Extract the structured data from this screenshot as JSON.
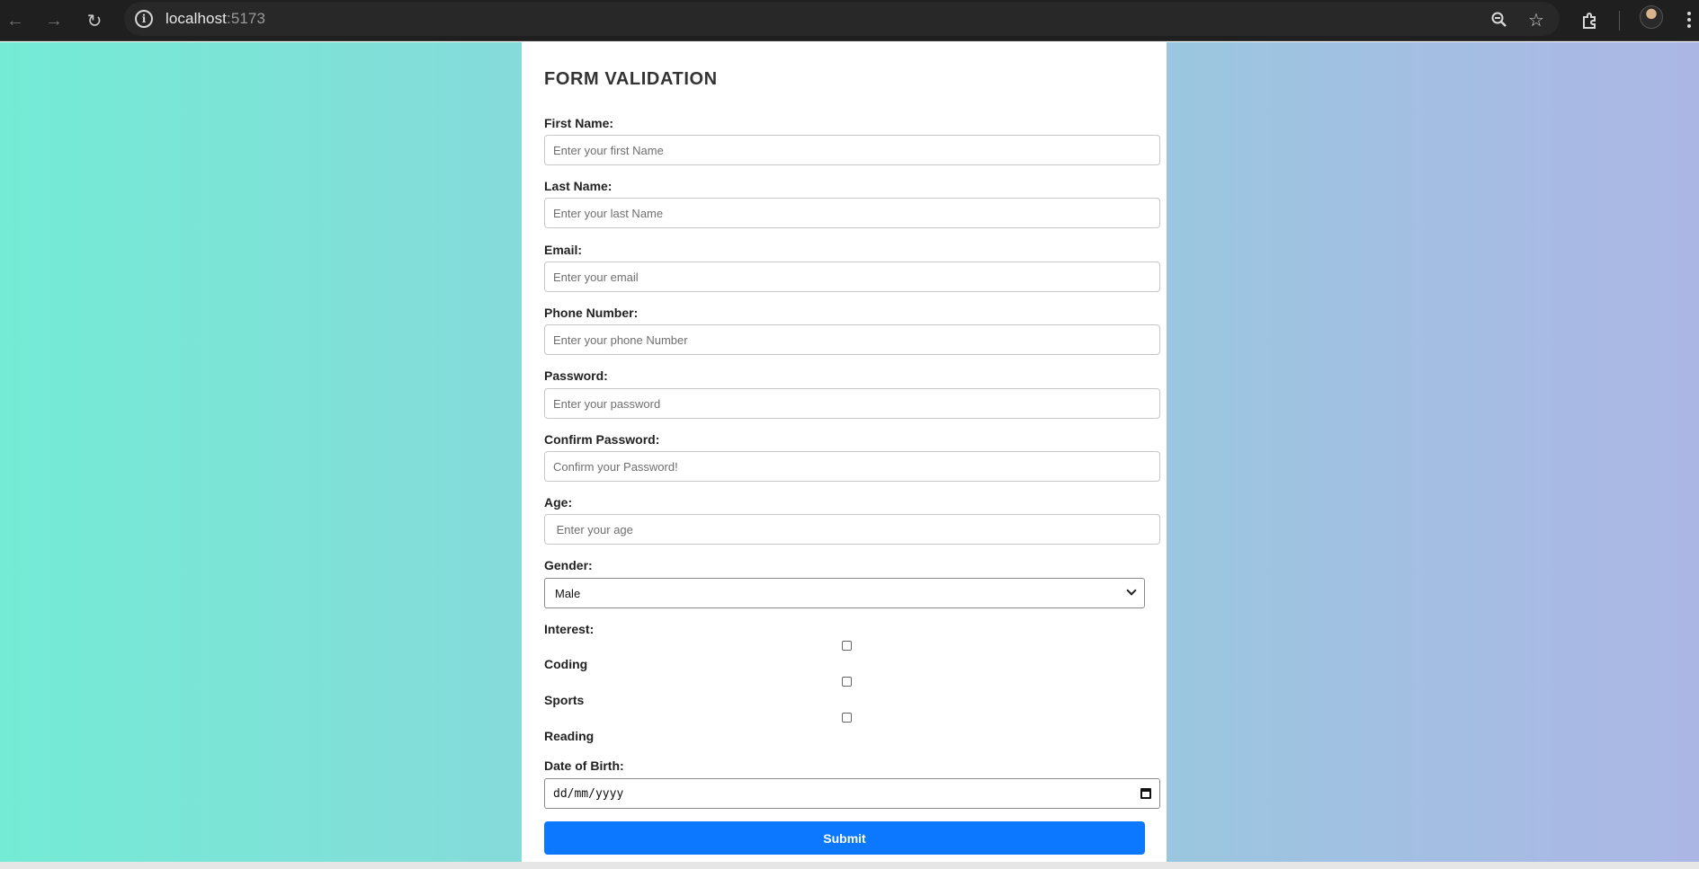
{
  "browser": {
    "url_host": "localhost",
    "url_port": ":5173",
    "icons": [
      "back-icon",
      "forward-icon",
      "reload-icon",
      "site-info-icon",
      "zoom-icon",
      "bookmark-star-icon",
      "extensions-icon",
      "profile-avatar",
      "menu-icon"
    ]
  },
  "form": {
    "title": "FORM VALIDATION",
    "first_name": {
      "label": "First Name:",
      "placeholder": "Enter your first Name"
    },
    "last_name": {
      "label": "Last Name:",
      "placeholder": "Enter your last Name"
    },
    "email": {
      "label": "Email:",
      "placeholder": "Enter your email"
    },
    "phone": {
      "label": "Phone Number:",
      "placeholder": "Enter your phone Number"
    },
    "password": {
      "label": "Password:",
      "placeholder": "Enter your password"
    },
    "confirm_password": {
      "label": "Confirm Password:",
      "placeholder": "Confirm your Password!"
    },
    "age": {
      "label": "Age:",
      "placeholder": " Enter your age"
    },
    "gender": {
      "label": "Gender:",
      "selected": "Male"
    },
    "interest": {
      "label": "Interest:",
      "options": [
        "Coding",
        "Sports",
        "Reading"
      ]
    },
    "dob": {
      "label": "Date of Birth:",
      "placeholder": "dd/mm/yyyy"
    },
    "submit_label": "Submit"
  },
  "colors": {
    "gradient_start": "#74ebd5",
    "gradient_end": "#acb6e5",
    "submit_bg": "#0b78ff",
    "browser_bar": "#1f1f1f"
  }
}
